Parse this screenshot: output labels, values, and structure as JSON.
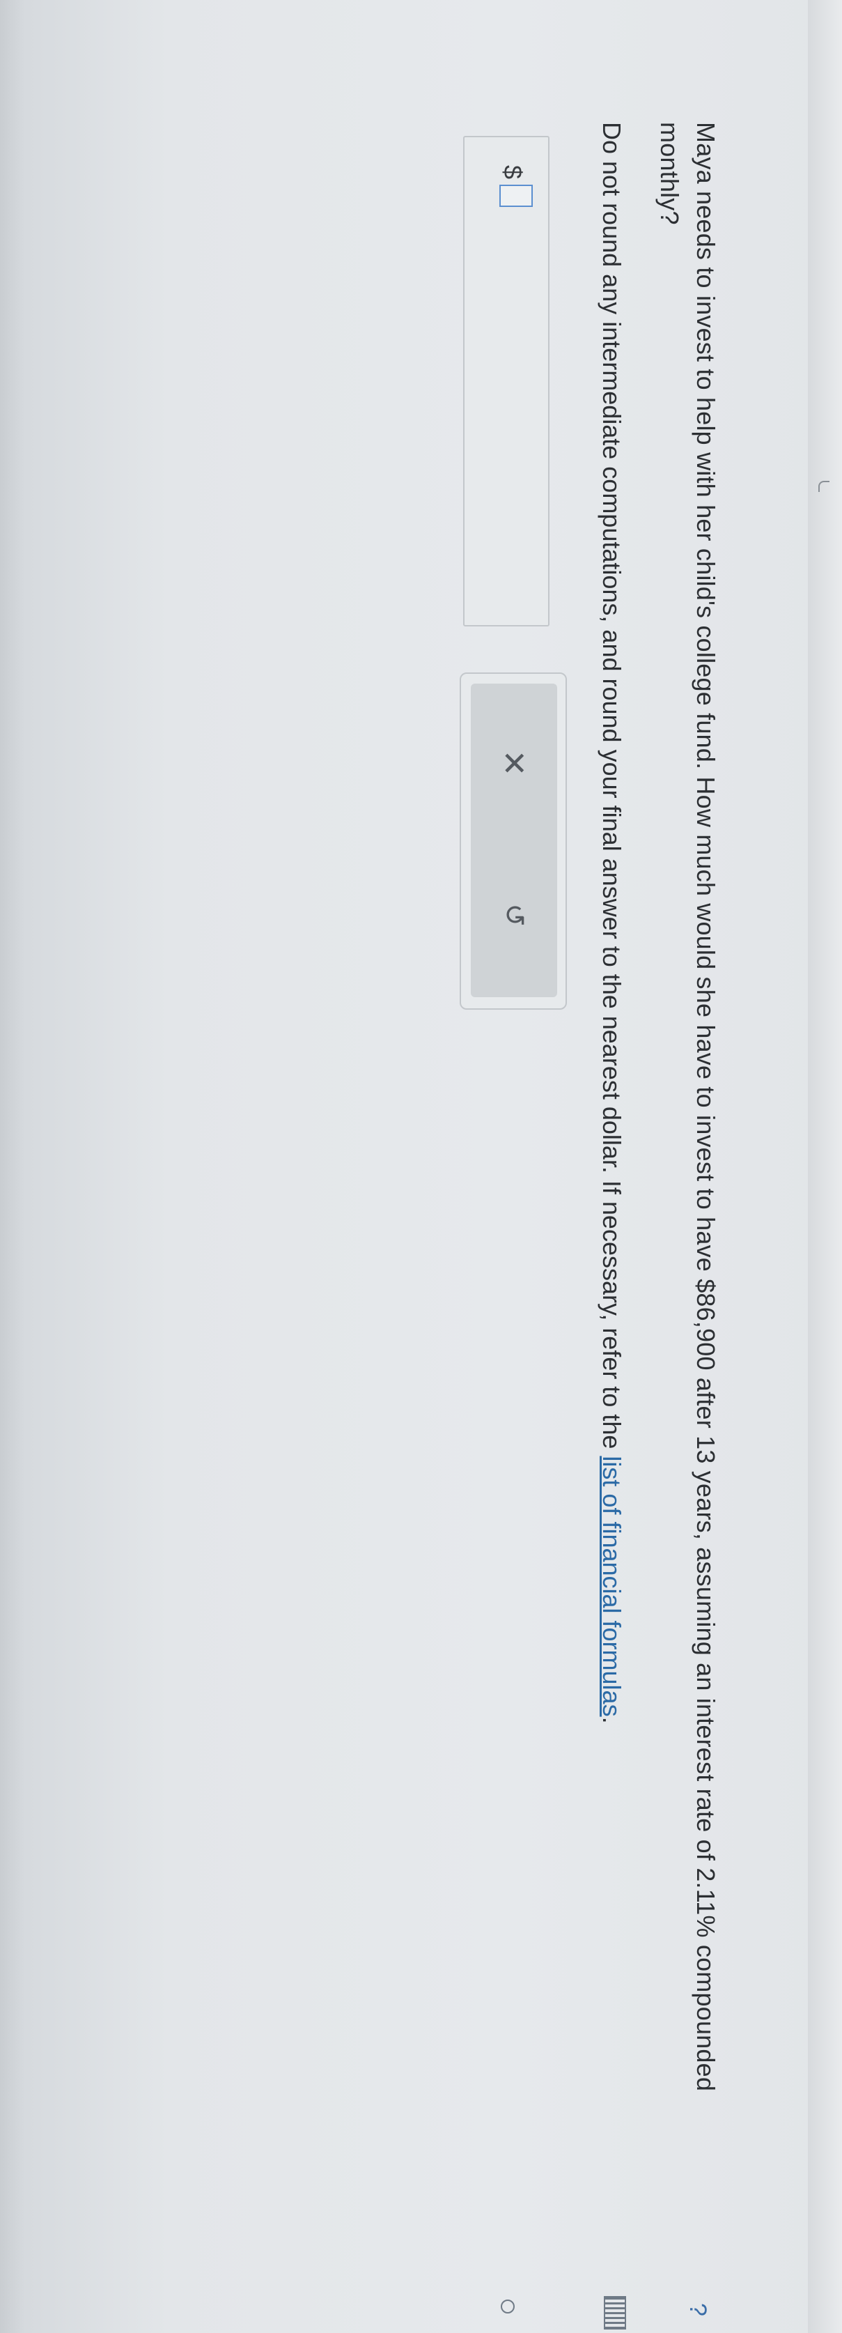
{
  "question": {
    "text": "Maya needs to invest to help with her child's college fund. How much would she have to invest to have $86,900 after 13 years, assuming an interest rate of 2.11% compounded monthly?"
  },
  "instruction": {
    "text": "Do not round any intermediate computations, and round your final answer to the nearest dollar. If necessary, refer to the ",
    "link_label": "list of financial formulas",
    "suffix": "."
  },
  "answer": {
    "prefix": "$",
    "value": "",
    "placeholder": ""
  },
  "actions": {
    "clear_icon": "close-icon",
    "undo_icon": "undo-icon"
  },
  "side_icons": {
    "help": "?",
    "calculator_icon": "calculator-icon",
    "circle_icon": "circle-icon"
  },
  "colors": {
    "link": "#2b6aa6",
    "focus_border": "#5b8fd0"
  }
}
